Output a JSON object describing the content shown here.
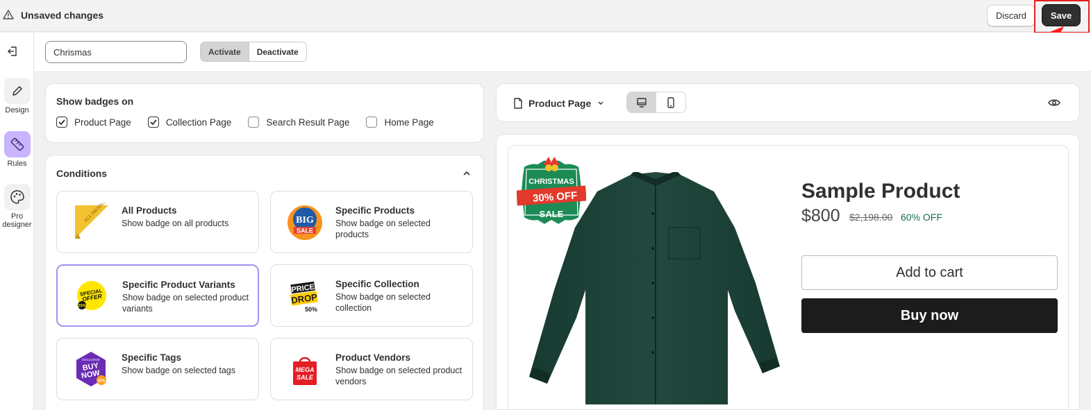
{
  "topbar": {
    "title": "Unsaved changes",
    "discard_label": "Discard",
    "save_label": "Save"
  },
  "rail": {
    "items": [
      {
        "label": "Design",
        "icon": "pencil-icon"
      },
      {
        "label": "Rules",
        "icon": "ruler-icon"
      },
      {
        "label": "Pro",
        "label2": "designer",
        "icon": "palette-icon"
      }
    ]
  },
  "subbar": {
    "name_value": "Chrismas",
    "activate_label": "Activate",
    "deactivate_label": "Deactivate"
  },
  "show_badges": {
    "title": "Show badges on",
    "options": [
      {
        "label": "Product Page",
        "checked": true
      },
      {
        "label": "Collection Page",
        "checked": true
      },
      {
        "label": "Search Result Page",
        "checked": false
      },
      {
        "label": "Home Page",
        "checked": false
      }
    ]
  },
  "conditions": {
    "title": "Conditions",
    "items": [
      {
        "title": "All Products",
        "desc": "Show badge on all products",
        "badge_text": "ALL PRODUCTS"
      },
      {
        "title": "Specific Products",
        "desc": "Show badge on selected products",
        "badge_text1": "BIG",
        "badge_text2": "SALE"
      },
      {
        "title": "Specific Product Variants",
        "desc": "Show badge on selected product variants",
        "badge_text1": "SPECIAL",
        "badge_text2": "OFFER",
        "badge_text3": "25%"
      },
      {
        "title": "Specific Collection",
        "desc": "Show badge on selected collection",
        "badge_text1": "PRICE",
        "badge_text2": "DROP",
        "badge_text3": "50%"
      },
      {
        "title": "Specific Tags",
        "desc": "Show badge on selected tags",
        "badge_text0": "EXCLUSIVE",
        "badge_text1": "BUY",
        "badge_text2": "NOW",
        "badge_text3": "20%"
      },
      {
        "title": "Product Vendors",
        "desc": "Show badge on selected product vendors",
        "badge_text1": "MEGA",
        "badge_text2": "SALE"
      }
    ]
  },
  "preview": {
    "page_label": "Product Page",
    "badge": {
      "line1": "CHRISTMAS",
      "line2": "30% OFF",
      "line3": "SALE"
    },
    "product": {
      "title": "Sample Product",
      "price": "$800",
      "compare_price": "$2,198.00",
      "discount": "60% OFF",
      "add_to_cart": "Add to cart",
      "buy_now": "Buy now"
    }
  },
  "colors": {
    "accent_purple": "#c9b4ff",
    "selected_border": "#9e93f0",
    "save_bg": "#303030",
    "highlight_red": "#e02020",
    "shirt_green": "#1f463c",
    "badge_green": "#1c8b55",
    "badge_red": "#e23a2c"
  }
}
